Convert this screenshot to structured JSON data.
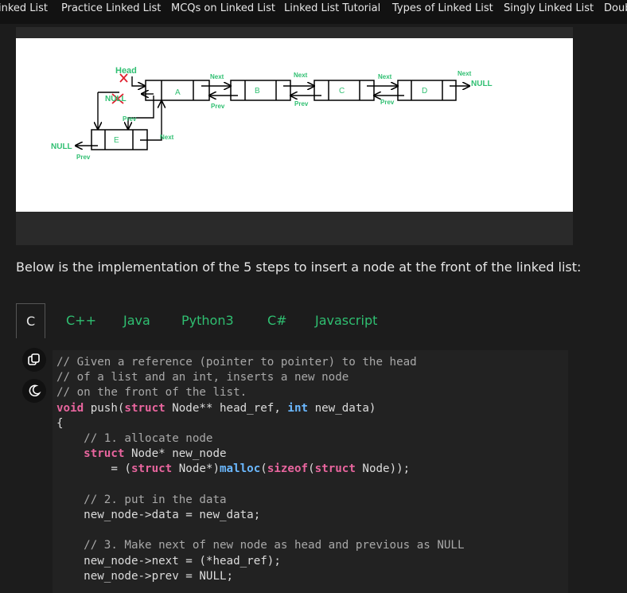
{
  "nav": {
    "items": [
      "inked List",
      "Practice Linked List",
      "MCQs on Linked List",
      "Linked List Tutorial",
      "Types of Linked List",
      "Singly Linked List",
      "Doub"
    ]
  },
  "diagram": {
    "head_label": "Head",
    "null_label": "NULL",
    "next_label": "Next",
    "prev_label": "Prev",
    "nodes": [
      "A",
      "B",
      "C",
      "D",
      "E"
    ],
    "null_right": "NULL",
    "null_left": "NULL"
  },
  "intro_text": "Below is the implementation of the 5 steps to insert a node at the front of the linked list:",
  "tabs": [
    "C",
    "C++",
    "Java",
    "Python3",
    "C#",
    "Javascript"
  ],
  "active_tab": "C",
  "icons": {
    "copy": "copy-icon",
    "theme": "moon-icon"
  },
  "code": {
    "lines": [
      "// Given a reference (pointer to pointer) to the head",
      "// of a list and an int, inserts a new node",
      "// on the front of the list.",
      "void push(struct Node** head_ref, int new_data)",
      "{",
      "    // 1. allocate node",
      "    struct Node* new_node",
      "        = (struct Node*)malloc(sizeof(struct Node));",
      "",
      "    // 2. put in the data",
      "    new_node->data = new_data;",
      "",
      "    // 3. Make next of new node as head and previous as NULL",
      "    new_node->next = (*head_ref);",
      "    new_node->prev = NULL;"
    ]
  },
  "colors": {
    "accent_green": "#2fbf71",
    "keyword": "#e8659e",
    "type": "#6bb8ff",
    "cross": "#e0202e"
  }
}
